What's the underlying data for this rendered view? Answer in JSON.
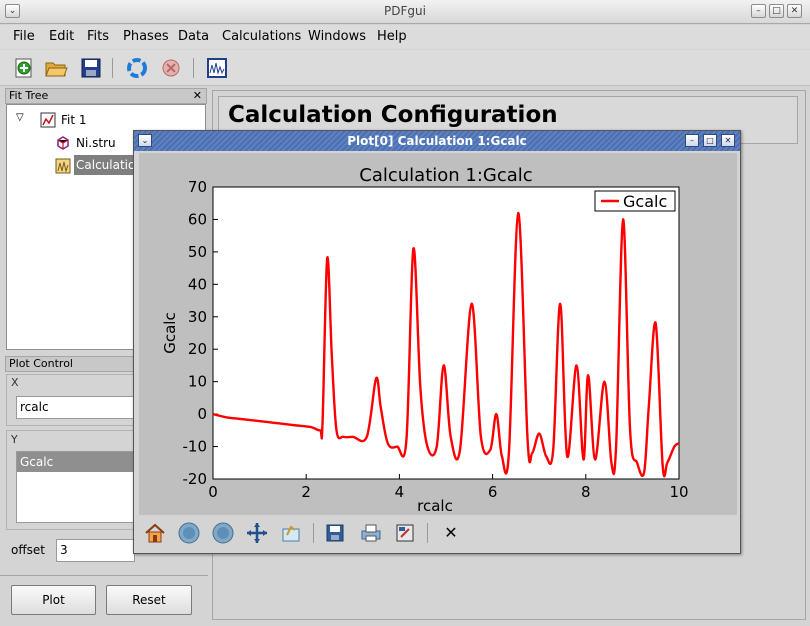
{
  "window": {
    "title": "PDFgui"
  },
  "menubar": {
    "items": [
      "File",
      "Edit",
      "Fits",
      "Phases",
      "Data",
      "Calculations",
      "Windows",
      "Help"
    ]
  },
  "fit_tree": {
    "header": "Fit Tree",
    "close_glyph": "✕",
    "root": "Fit 1",
    "children": [
      "Ni.stru",
      "Calculatio"
    ]
  },
  "plot_control": {
    "header": "Plot Control",
    "x_label": "X",
    "x_value": "rcalc",
    "y_label": "Y",
    "y_selected": "Gcalc",
    "offset_label": "offset",
    "offset_value": "3",
    "plot_button": "Plot",
    "reset_button": "Reset"
  },
  "main": {
    "title": "Calculation Configuration"
  },
  "plot_window": {
    "title": "Plot[0]  Calculation 1:Gcalc",
    "close_glyph": "✕"
  },
  "chart_data": {
    "type": "line",
    "title": "Calculation 1:Gcalc",
    "xlabel": "rcalc",
    "ylabel": "Gcalc",
    "xlim": [
      0,
      10
    ],
    "ylim": [
      -20,
      70
    ],
    "xticks": [
      "0",
      "2",
      "4",
      "6",
      "8",
      "10"
    ],
    "yticks": [
      "-20",
      "-10",
      "0",
      "10",
      "20",
      "30",
      "40",
      "50",
      "60",
      "70"
    ],
    "legend": "top-right",
    "color": "#ff0000",
    "series": [
      {
        "name": "Gcalc",
        "x": [
          0,
          0.3,
          0.6,
          0.9,
          1.2,
          1.5,
          1.8,
          2.1,
          2.3,
          2.35,
          2.45,
          2.55,
          2.65,
          2.8,
          3.0,
          3.3,
          3.5,
          3.6,
          3.75,
          3.95,
          4.15,
          4.3,
          4.45,
          4.6,
          4.8,
          4.95,
          5.1,
          5.3,
          5.55,
          5.75,
          5.95,
          6.08,
          6.2,
          6.35,
          6.55,
          6.75,
          6.85,
          7.0,
          7.15,
          7.3,
          7.45,
          7.6,
          7.8,
          7.95,
          8.05,
          8.2,
          8.4,
          8.55,
          8.65,
          8.8,
          8.95,
          9.1,
          9.25,
          9.35,
          9.5,
          9.65,
          9.75,
          9.9,
          10.0
        ],
        "y": [
          0,
          -1,
          -1.5,
          -2,
          -2.5,
          -3,
          -3.5,
          -4,
          -5,
          -3,
          48,
          18,
          -5,
          -7,
          -7,
          -7,
          11,
          2,
          -9,
          -10,
          -8,
          51,
          8,
          -10,
          -10,
          15,
          -7,
          -11,
          34,
          -7,
          -11,
          0,
          -13,
          -12,
          62,
          -8,
          -12,
          -6,
          -13,
          -11,
          34,
          -13,
          15,
          -14,
          12,
          -14,
          10,
          -15,
          -10,
          60,
          -5,
          -15,
          -18,
          2,
          28,
          -16,
          -15,
          -10,
          -9
        ]
      }
    ]
  }
}
